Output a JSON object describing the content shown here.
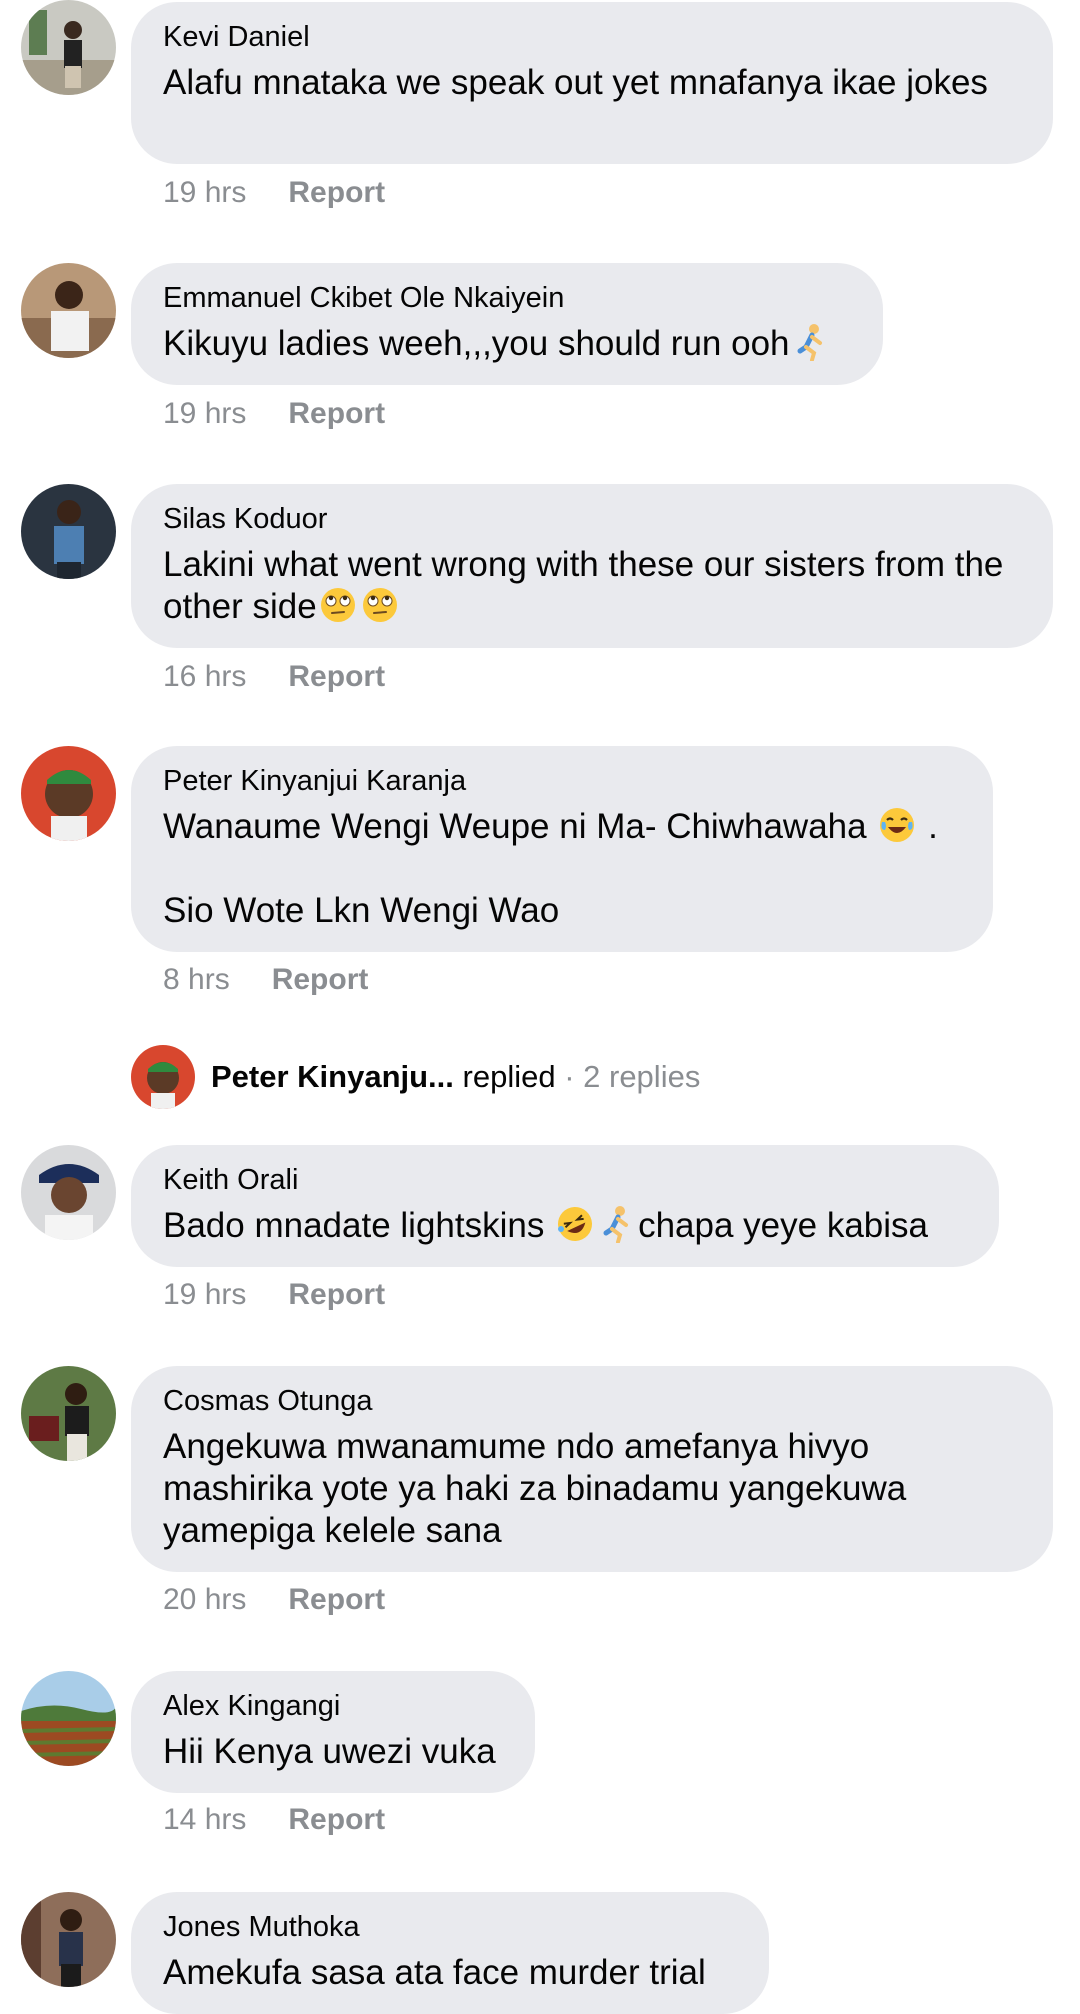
{
  "comments": [
    {
      "author": "Kevi Daniel",
      "text": "Alafu mnataka we speak out yet mnafanya ikae jokes",
      "time": "19 hrs",
      "report": "Report"
    },
    {
      "author": "Emmanuel Ckibet Ole Nkaiyein",
      "text": "Kikuyu ladies weeh,,,you should run ooh",
      "time": "19 hrs",
      "report": "Report"
    },
    {
      "author": "Silas Koduor",
      "text": "Lakini what went wrong with these our sisters from the other side",
      "time": "16 hrs",
      "report": "Report"
    },
    {
      "author": "Peter Kinyanjui Karanja",
      "text_line1": "Wanaume Wengi Weupe ni Ma- Chiwhawaha",
      "text_line1_tail": ".",
      "text_line2": "Sio Wote Lkn Wengi Wao",
      "time": "8 hrs",
      "report": "Report"
    },
    {
      "author": "Keith Orali",
      "text_start": "Bado mnadate lightskins",
      "text_end": "chapa yeye kabisa",
      "time": "19 hrs",
      "report": "Report"
    },
    {
      "author": "Cosmas Otunga",
      "text": "Angekuwa mwanamume ndo amefanya hivyo mashirika yote ya haki za binadamu yangekuwa yamepiga kelele sana",
      "time": "20 hrs",
      "report": "Report"
    },
    {
      "author": "Alex Kingangi",
      "text": "Hii Kenya uwezi vuka",
      "time": "14 hrs",
      "report": "Report"
    },
    {
      "author": "Jones Muthoka",
      "text": "Amekufa sasa ata face murder trial"
    }
  ],
  "reply_summary": {
    "name": "Peter Kinyanju...",
    "action": " replied",
    "count": " · 2 replies"
  },
  "icons": {
    "running": "person-running-icon",
    "eyeroll": "face-with-rolling-eyes-icon",
    "tears_joy": "face-with-tears-of-joy-icon",
    "rofl": "rolling-on-the-floor-laughing-icon"
  },
  "colors": {
    "bubble": "#e9eaee",
    "meta": "#8a8d91",
    "text": "#050505"
  }
}
